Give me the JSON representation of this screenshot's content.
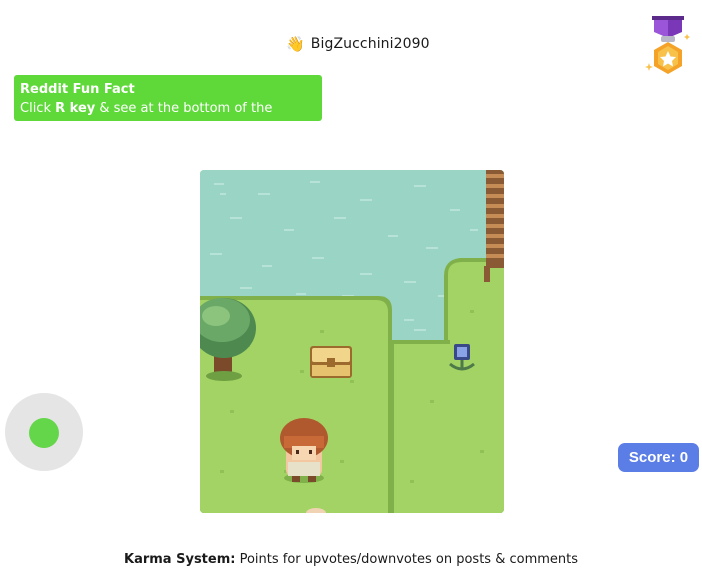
{
  "header": {
    "wave_emoji": "👋",
    "username": "BigZucchini2090"
  },
  "icons": {
    "medal": "medal-icon",
    "wave": "waving-hand-icon"
  },
  "fun_fact": {
    "title": "Reddit Fun Fact",
    "line_prefix": "Click ",
    "key": "R key",
    "line_suffix": " & see at the bottom of the screen"
  },
  "score": {
    "label": "Score: 0"
  },
  "footer": {
    "karma_label": "Karma System:",
    "karma_text": " Points for upvotes/downvotes on posts & comments"
  },
  "colors": {
    "fact_bg": "#5fd93a",
    "score_bg": "#5b7de6",
    "joystick_knob": "#64d64a",
    "water": "#9ad4c4",
    "grass": "#9acf5d"
  }
}
